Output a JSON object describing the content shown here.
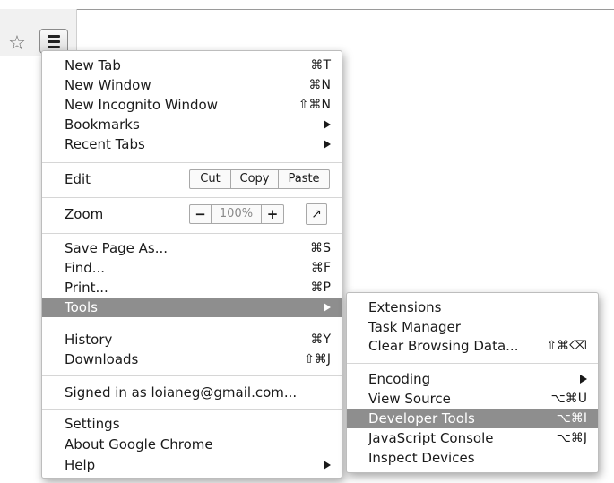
{
  "menu": {
    "group1": [
      {
        "label": "New Tab",
        "shortcut": "⌘T"
      },
      {
        "label": "New Window",
        "shortcut": "⌘N"
      },
      {
        "label": "New Incognito Window",
        "shortcut": "⇧⌘N"
      },
      {
        "label": "Bookmarks"
      },
      {
        "label": "Recent Tabs"
      }
    ],
    "edit": {
      "label": "Edit",
      "cut": "Cut",
      "copy": "Copy",
      "paste": "Paste"
    },
    "zoom": {
      "label": "Zoom",
      "minus": "−",
      "value": "100%",
      "plus": "+",
      "fullscreen": "↗"
    },
    "group3": [
      {
        "label": "Save Page As...",
        "shortcut": "⌘S"
      },
      {
        "label": "Find...",
        "shortcut": "⌘F"
      },
      {
        "label": "Print...",
        "shortcut": "⌘P"
      },
      {
        "label": "Tools"
      }
    ],
    "group4": [
      {
        "label": "History",
        "shortcut": "⌘Y"
      },
      {
        "label": "Downloads",
        "shortcut": "⇧⌘J"
      }
    ],
    "signed_in": "Signed in as loianeg@gmail.com...",
    "group6": [
      {
        "label": "Settings"
      },
      {
        "label": "About Google Chrome"
      },
      {
        "label": "Help"
      }
    ]
  },
  "tools_submenu": {
    "group1": [
      {
        "label": "Extensions"
      },
      {
        "label": "Task Manager"
      },
      {
        "label": "Clear Browsing Data...",
        "shortcut": "⇧⌘⌫"
      }
    ],
    "group2": [
      {
        "label": "Encoding"
      },
      {
        "label": "View Source",
        "shortcut": "⌥⌘U"
      },
      {
        "label": "Developer Tools",
        "shortcut": "⌥⌘I"
      },
      {
        "label": "JavaScript Console",
        "shortcut": "⌥⌘J"
      },
      {
        "label": "Inspect Devices"
      }
    ]
  },
  "colors": {
    "highlight": "#8e8e8e",
    "highlight_text": "#ffffff"
  },
  "icons": {
    "star": "star-icon",
    "menu": "hamburger-menu-icon"
  }
}
